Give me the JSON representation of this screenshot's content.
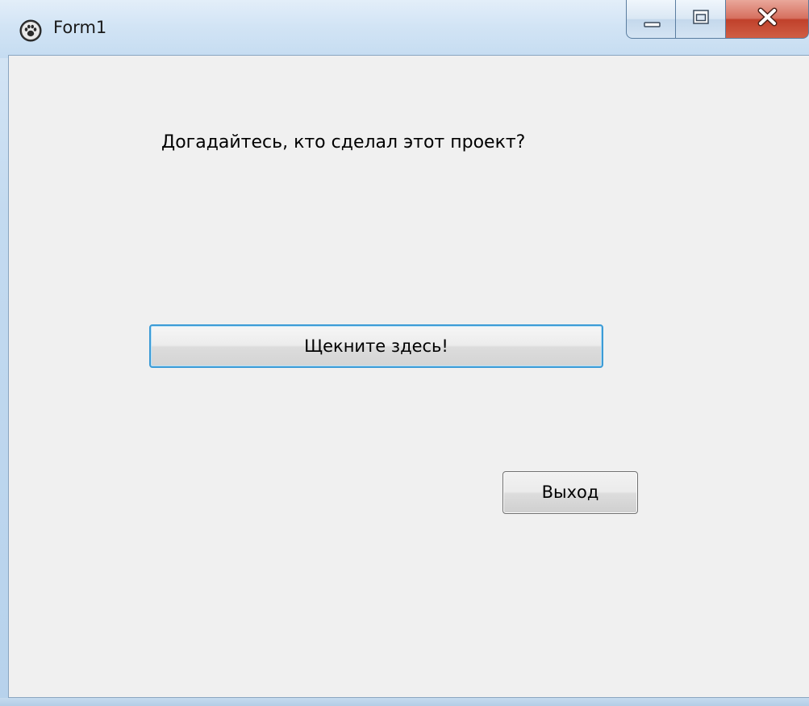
{
  "window": {
    "title": "Form1",
    "app_icon": "paw-icon",
    "caption_buttons": {
      "minimize_icon": "minimize-icon",
      "maximize_icon": "maximize-icon",
      "close_icon": "close-icon"
    }
  },
  "form": {
    "question_text": "Догадайтесь, кто сделал этот проект?",
    "click_button_label": "Щекните здесь!",
    "exit_button_label": "Выход"
  },
  "colors": {
    "client_background": "#f0f0f0",
    "focused_button_border": "#3c9bd6",
    "close_button": "#c0412b"
  }
}
